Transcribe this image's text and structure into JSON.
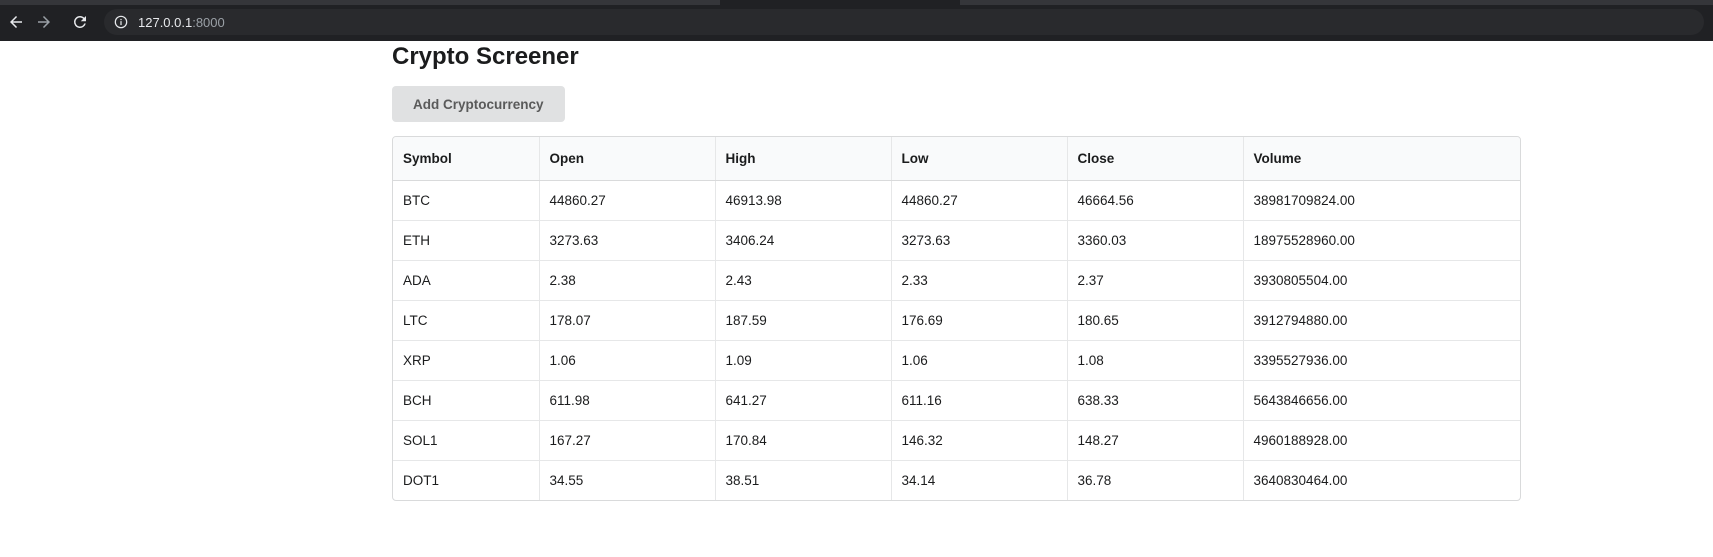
{
  "browser": {
    "url_host": "127.0.0.1",
    "url_port": ":8000"
  },
  "page": {
    "title": "Crypto Screener",
    "add_button_label": "Add Cryptocurrency"
  },
  "table": {
    "columns": [
      "Symbol",
      "Open",
      "High",
      "Low",
      "Close",
      "Volume"
    ],
    "rows": [
      [
        "BTC",
        "44860.27",
        "46913.98",
        "44860.27",
        "46664.56",
        "38981709824.00"
      ],
      [
        "ETH",
        "3273.63",
        "3406.24",
        "3273.63",
        "3360.03",
        "18975528960.00"
      ],
      [
        "ADA",
        "2.38",
        "2.43",
        "2.33",
        "2.37",
        "3930805504.00"
      ],
      [
        "LTC",
        "178.07",
        "187.59",
        "176.69",
        "180.65",
        "3912794880.00"
      ],
      [
        "XRP",
        "1.06",
        "1.09",
        "1.06",
        "1.08",
        "3395527936.00"
      ],
      [
        "BCH",
        "611.98",
        "641.27",
        "611.16",
        "638.33",
        "5643846656.00"
      ],
      [
        "SOL1",
        "167.27",
        "170.84",
        "146.32",
        "148.27",
        "4960188928.00"
      ],
      [
        "DOT1",
        "34.55",
        "38.51",
        "34.14",
        "36.78",
        "3640830464.00"
      ]
    ]
  },
  "icons": {
    "back": "arrow-left-icon",
    "forward": "arrow-right-icon",
    "reload": "reload-icon",
    "info": "info-icon"
  }
}
